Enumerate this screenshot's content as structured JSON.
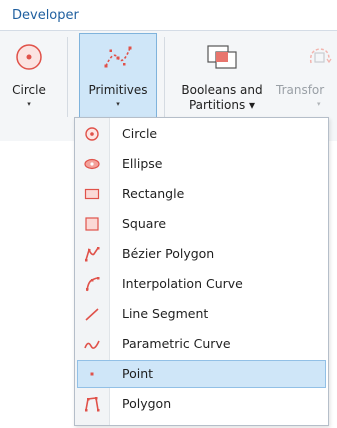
{
  "tab": {
    "label": "Developer"
  },
  "ribbon": {
    "circle": {
      "label": "Circle",
      "caret": "▾"
    },
    "primitives": {
      "label": "Primitives",
      "caret": "▾"
    },
    "booleans": {
      "label_line1": "Booleans and",
      "label_line2": "Partitions ▾"
    },
    "transforms": {
      "label": "Transfor",
      "caret": "▾"
    }
  },
  "menu": {
    "items": [
      {
        "label": "Circle",
        "icon": "circle-icon"
      },
      {
        "label": "Ellipse",
        "icon": "ellipse-icon"
      },
      {
        "label": "Rectangle",
        "icon": "rectangle-icon"
      },
      {
        "label": "Square",
        "icon": "square-icon"
      },
      {
        "label": "Bézier Polygon",
        "icon": "bezier-polygon-icon"
      },
      {
        "label": "Interpolation Curve",
        "icon": "interpolation-curve-icon"
      },
      {
        "label": "Line Segment",
        "icon": "line-segment-icon"
      },
      {
        "label": "Parametric Curve",
        "icon": "parametric-curve-icon"
      },
      {
        "label": "Point",
        "icon": "point-icon",
        "highlighted": true
      },
      {
        "label": "Polygon",
        "icon": "polygon-icon"
      }
    ]
  },
  "colors": {
    "accent_red": "#e0524a",
    "tab_blue": "#1f5f9f",
    "highlight": "#cfe6f8"
  }
}
